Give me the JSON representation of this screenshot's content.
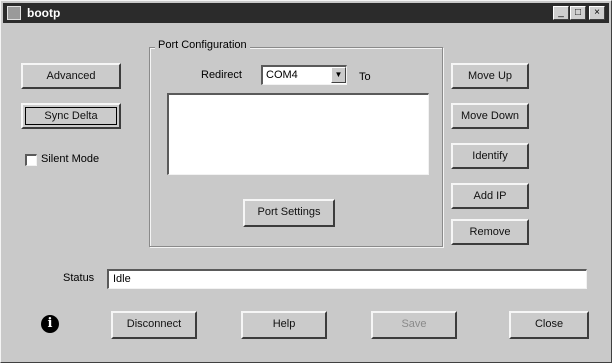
{
  "window": {
    "title": "bootp",
    "controls": {
      "minimize": "_",
      "maximize": "□",
      "close": "×"
    }
  },
  "left_panel": {
    "advanced_label": "Advanced",
    "sync_label": "Sync Delta",
    "silent_mode_label": "Silent Mode",
    "silent_mode_checked": false
  },
  "port_config": {
    "group_label": "Port Configuration",
    "redirect_label": "Redirect",
    "port_value": "COM4",
    "to_label": "To",
    "list_items": [],
    "port_settings_label": "Port Settings"
  },
  "right_panel": {
    "move_up_label": "Move Up",
    "move_down_label": "Move Down",
    "identify_label": "Identify",
    "add_ip_label": "Add IP",
    "remove_label": "Remove"
  },
  "status": {
    "label": "Status",
    "value": "Idle"
  },
  "footer": {
    "disconnect_label": "Disconnect",
    "help_label": "Help",
    "save_label": "Save",
    "close_label": "Close"
  }
}
